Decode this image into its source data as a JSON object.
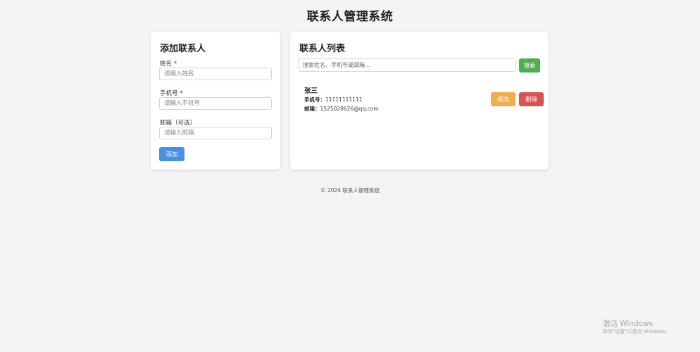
{
  "header": {
    "title": "联系人管理系统"
  },
  "add_form": {
    "title": "添加联系人",
    "name_label": "姓名 *",
    "name_placeholder": "请输入姓名",
    "phone_label": "手机号 *",
    "phone_placeholder": "请输入手机号",
    "email_label": "邮箱（可选）",
    "email_placeholder": "请输入邮箱",
    "submit_label": "添加"
  },
  "contact_list": {
    "title": "联系人列表",
    "search_placeholder": "搜索姓名、手机号或邮箱...",
    "search_button": "搜索",
    "phone_field_label": "手机号：",
    "email_field_label": "邮箱：",
    "edit_label": "修改",
    "delete_label": "删除",
    "contacts": [
      {
        "name": "张三",
        "phone": "11111111111",
        "email": "1525028626@qq.com"
      }
    ]
  },
  "footer": {
    "text": "© 2024 联系人管理系统"
  },
  "watermark": {
    "title": "激活 Windows",
    "subtitle": "转到\"设置\"以激活 Windows。"
  },
  "colors": {
    "add_button": "#4a90e2",
    "search_button": "#4caf50",
    "edit_button": "#f0ad4e",
    "delete_button": "#d9534f",
    "background": "#f4f4f4"
  }
}
